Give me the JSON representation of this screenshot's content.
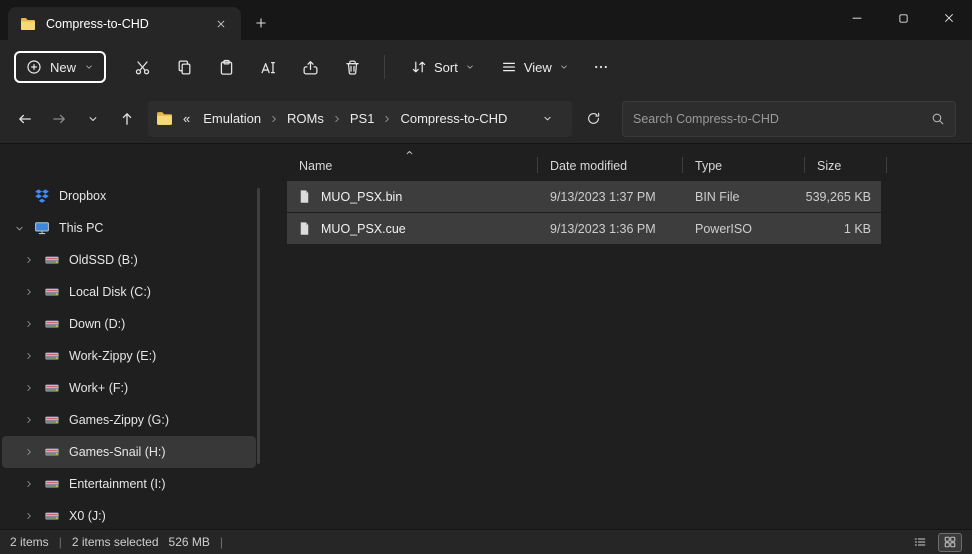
{
  "window": {
    "tab_title": "Compress-to-CHD"
  },
  "toolbar": {
    "new_label": "New",
    "sort_label": "Sort",
    "view_label": "View"
  },
  "address": {
    "overflow": "«",
    "crumbs": [
      "Emulation",
      "ROMs",
      "PS1",
      "Compress-to-CHD"
    ],
    "search_placeholder": "Search Compress-to-CHD"
  },
  "sidebar": {
    "items": [
      {
        "label": "Dropbox"
      },
      {
        "label": "This PC"
      },
      {
        "label": "OldSSD (B:)"
      },
      {
        "label": "Local Disk (C:)"
      },
      {
        "label": "Down (D:)"
      },
      {
        "label": "Work-Zippy (E:)"
      },
      {
        "label": "Work+ (F:)"
      },
      {
        "label": "Games-Zippy (G:)"
      },
      {
        "label": "Games-Snail (H:)"
      },
      {
        "label": "Entertainment (I:)"
      },
      {
        "label": "X0 (J:)"
      }
    ]
  },
  "filelist": {
    "columns": {
      "name": "Name",
      "date": "Date modified",
      "type": "Type",
      "size": "Size"
    },
    "rows": [
      {
        "name": "MUO_PSX.bin",
        "date": "9/13/2023 1:37 PM",
        "type": "BIN File",
        "size": "539,265 KB"
      },
      {
        "name": "MUO_PSX.cue",
        "date": "9/13/2023 1:36 PM",
        "type": "PowerISO",
        "size": "1 KB"
      }
    ]
  },
  "statusbar": {
    "items": "2 items",
    "selected": "2 items selected",
    "size": "526 MB",
    "divider": "|"
  }
}
